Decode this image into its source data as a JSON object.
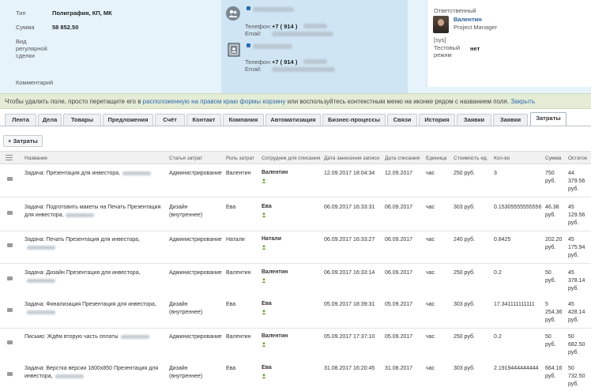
{
  "deal": {
    "type_label": "Тип",
    "type_value": "Полиграфия, КП, МК",
    "sum_label": "Сумма",
    "sum_value": "58 852.50",
    "regular_label_1": "Вид",
    "regular_label_2": "регулярной",
    "regular_label_3": "сделки",
    "comment_label": "Комментарий"
  },
  "contacts": [
    {
      "phone_label": "Телефон:",
      "phone_value": "+7 ( 914 )",
      "email_label": "Email:"
    },
    {
      "phone_label": "Телефон:",
      "phone_value": "+7 ( 914 )",
      "email_label": "Email:"
    }
  ],
  "responsible": {
    "header": "Ответственный",
    "name": "Валентин",
    "role": "Project Manager",
    "sys_label": "[sys]",
    "test_label_1": "Тестовый",
    "test_label_2": "режим",
    "test_value": "нет"
  },
  "infobar": {
    "text_before": "Чтобы удалить поле, просто перетащите его в ",
    "link1": "расположенную на правом краю формы корзину",
    "text_middle": " или воспользуйтесь контекстным меню на иконке рядом с названием поля. ",
    "link2": "Закрыть"
  },
  "tabs": [
    "Лента",
    "Дела",
    "Товары",
    "Предложения",
    "Счёт",
    "Контакт",
    "Компания",
    "Автоматизация",
    "Бизнес-процессы",
    "Связи",
    "История",
    "Заявки",
    "Заявки",
    "Затраты"
  ],
  "add_button": "+ Затраты",
  "columns": [
    "Название",
    "Статья затрат",
    "Роль затрат",
    "Сотрудник для списания",
    "Дата занесения записи",
    "Дата списания",
    "Единица",
    "Стоимость ед.",
    "Кол-во",
    "Сумма",
    "Остаток"
  ],
  "rows": [
    {
      "name1": "Задача: Презентация для инвестора,",
      "name2": "",
      "article1": "Администрирование",
      "article2": "",
      "role": "Валентин",
      "employee": "Валентин",
      "created": "12.09.2017 18:04:34",
      "written": "12.09.2017",
      "unit": "час",
      "price": "250 руб.",
      "qty": "3",
      "sum1": "750",
      "sum2": "руб.",
      "rest1": "44",
      "rest2": "379.56",
      "rest3": "руб."
    },
    {
      "name1": "Задача: Подготовить макеты на Печать Презентация",
      "name2": "для инвестора,",
      "article1": "Дизайн",
      "article2": "(внутреннее)",
      "role": "Ева",
      "employee": "Ева",
      "created": "06.09.2017 16:33:31",
      "written": "06.09.2017",
      "unit": "час",
      "price": "303 руб.",
      "qty": "0.15305555555556",
      "sum1": "46.38",
      "sum2": "руб.",
      "rest1": "45",
      "rest2": "129.56",
      "rest3": "руб."
    },
    {
      "name1": "Задача: Печать Презентация для инвестора,",
      "name2": "",
      "article1": "Администрирование",
      "article2": "",
      "role": "Натали",
      "employee": "Натали",
      "created": "06.09.2017 16:33:27",
      "written": "06.09.2017",
      "unit": "час",
      "price": "240 руб.",
      "qty": "0.8425",
      "sum1": "202.20",
      "sum2": "руб.",
      "rest1": "45",
      "rest2": "175.94",
      "rest3": "руб."
    },
    {
      "name1": "Задача: Дизайн Презентация для инвестора,",
      "name2": "",
      "article1": "Администрирование",
      "article2": "",
      "role": "Валентин",
      "employee": "Валентин",
      "created": "06.09.2017 16:33:14",
      "written": "06.09.2017",
      "unit": "час",
      "price": "250 руб.",
      "qty": "0.2",
      "sum1": "50",
      "sum2": "руб.",
      "rest1": "45",
      "rest2": "378.14",
      "rest3": "руб."
    },
    {
      "name1": "Задача: Финализация Презентация для инвестора,",
      "name2": "",
      "article1": "Дизайн",
      "article2": "(внутреннее)",
      "role": "Ева",
      "employee": "Ева",
      "created": "05.09.2017 18:39:31",
      "written": "05.09.2017",
      "unit": "час",
      "price": "303 руб.",
      "qty": "17.341111111111",
      "sum1": "5",
      "sum2": "254.36",
      "sum3": "руб.",
      "rest1": "45",
      "rest2": "428.14",
      "rest3": "руб."
    },
    {
      "name1": "Письмо: Ждём вторую часть оплаты",
      "name2": "",
      "article1": "Администрирование",
      "article2": "",
      "role": "Валентин",
      "employee": "Валентин",
      "created": "05.09.2017 17:37:10",
      "written": "05.09.2017",
      "unit": "час",
      "price": "250 руб.",
      "qty": "0.2",
      "sum1": "50",
      "sum2": "руб.",
      "rest1": "50",
      "rest2": "682.50",
      "rest3": "руб."
    },
    {
      "name1": "Задача: Верстка версии 1800х850 Презентация для",
      "name2": "инвестора,",
      "article1": "Дизайн",
      "article2": "(внутреннее)",
      "role": "Ева",
      "employee": "Ева",
      "created": "31.08.2017 16:20:45",
      "written": "31.08.2017",
      "unit": "час",
      "price": "303 руб.",
      "qty": "2.1919444444444",
      "sum1": "664.16",
      "sum2": "руб.",
      "rest1": "50",
      "rest2": "732.50",
      "rest3": "руб."
    }
  ]
}
